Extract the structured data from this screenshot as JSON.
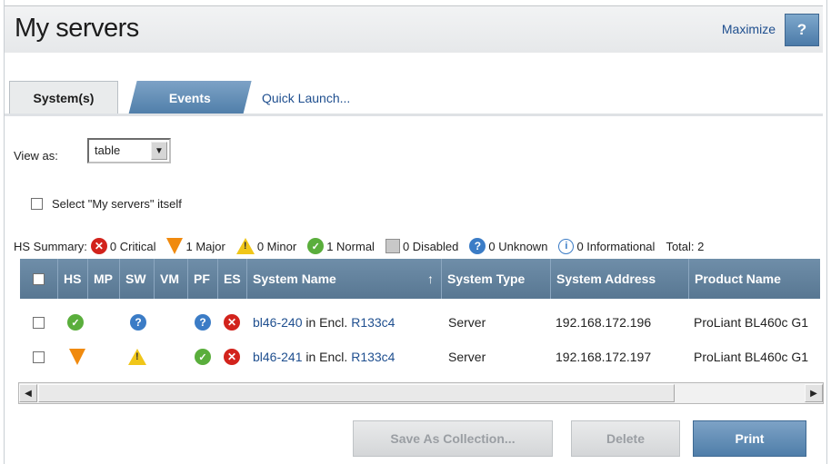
{
  "header": {
    "title": "My servers",
    "maximize_label": "Maximize",
    "help_label": "?"
  },
  "tabs": {
    "systems": "System(s)",
    "events": "Events",
    "quick_launch": "Quick Launch..."
  },
  "view_as": {
    "label": "View as:",
    "selected": "table"
  },
  "select_self_label": "Select \"My servers\" itself",
  "hs_summary": {
    "label": "HS Summary:",
    "critical": "0 Critical",
    "major": "1 Major",
    "minor": "0 Minor",
    "normal": "1 Normal",
    "disabled": "0 Disabled",
    "unknown": "0 Unknown",
    "informational": "0 Informational",
    "total": "Total: 2"
  },
  "table": {
    "columns": {
      "hs": "HS",
      "mp": "MP",
      "sw": "SW",
      "vm": "VM",
      "pf": "PF",
      "es": "ES",
      "system_name": "System Name",
      "sort_indicator": "↑",
      "system_type": "System Type",
      "system_address": "System Address",
      "product_name": "Product Name"
    },
    "rows": [
      {
        "hs_icon": "normal-icon",
        "sw_icon": "unknown-icon",
        "pf_icon": "unknown-icon",
        "es_icon": "critical-icon",
        "name": "bl46-240",
        "name_mid": " in Encl. ",
        "enclosure": "R133c4",
        "type": "Server",
        "address": "192.168.172.196",
        "product": "ProLiant BL460c G1"
      },
      {
        "hs_icon": "major-icon",
        "sw_icon": "minor-icon",
        "pf_icon": "normal-icon",
        "es_icon": "critical-icon",
        "name": "bl46-241",
        "name_mid": " in Encl. ",
        "enclosure": "R133c4",
        "type": "Server",
        "address": "192.168.172.197",
        "product": "ProLiant BL460c G1"
      }
    ]
  },
  "buttons": {
    "save_collection": "Save As Collection...",
    "delete": "Delete",
    "print": "Print"
  },
  "colors": {
    "accent": "#5b84ac",
    "header_bar": "#64839f",
    "critical": "#d2231c",
    "major": "#f08a0e",
    "minor": "#f0c619",
    "normal": "#5aae3c",
    "unknown": "#3b7cc6"
  }
}
